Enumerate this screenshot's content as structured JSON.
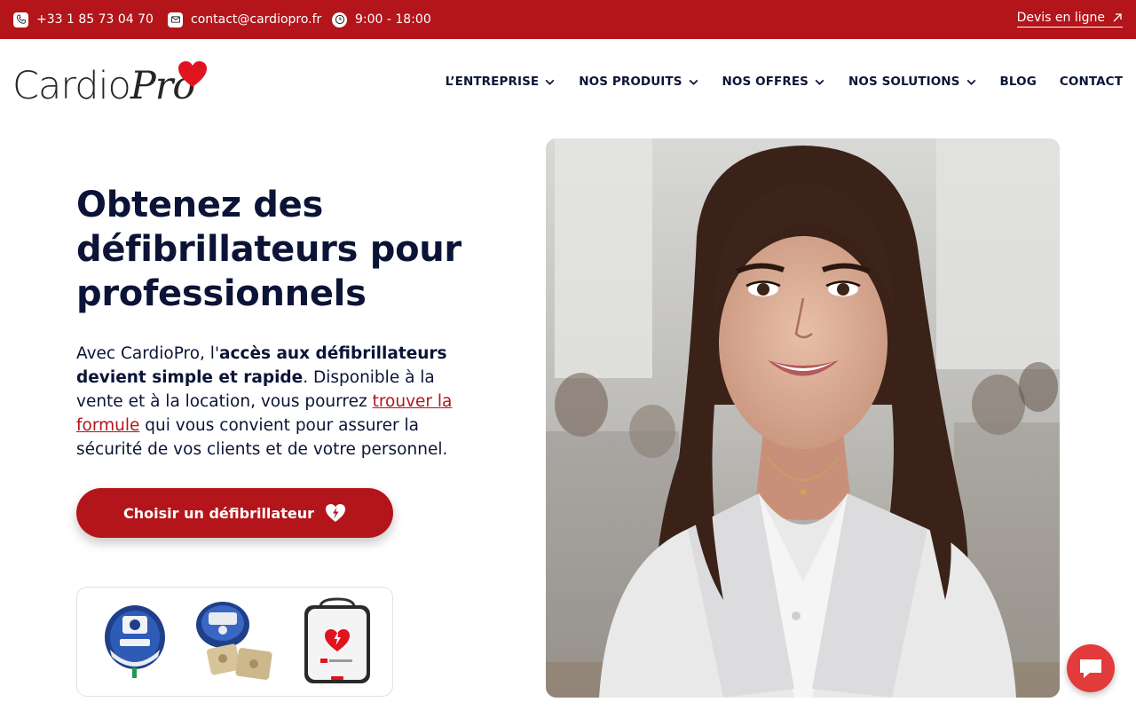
{
  "topbar": {
    "phone": "+33 1 85 73 04 70",
    "email": "contact@cardiopro.fr",
    "hours": "9:00 - 18:00",
    "devis_label": "Devis en ligne",
    "background": "#b3151b",
    "icons": [
      "phone-icon",
      "mail-icon",
      "clock-icon",
      "arrow-up-right-icon"
    ]
  },
  "logo": {
    "text_part1": "Cardio",
    "text_part2": "Pro",
    "heart_color": "#e0141e"
  },
  "nav": {
    "items": [
      {
        "label": "L’ENTREPRISE",
        "has_dropdown": true
      },
      {
        "label": "NOS PRODUITS",
        "has_dropdown": true
      },
      {
        "label": "NOS OFFRES",
        "has_dropdown": true
      },
      {
        "label": "NOS SOLUTIONS",
        "has_dropdown": true
      },
      {
        "label": "BLOG",
        "has_dropdown": false
      },
      {
        "label": "CONTACT",
        "has_dropdown": false
      }
    ]
  },
  "hero": {
    "title_line1": "Obtenez des",
    "title_line2": "défibrillateurs pour",
    "title_line3": "professionnels",
    "text_part1": "Avec CardioPro, l'",
    "text_bold": "accès aux défibrillateurs devient simple et rapide",
    "text_part2": ". Disponible à la vente et à la location, vous pourrez ",
    "text_link": "trouver la formule",
    "text_part3": " qui vous convient pour assurer la sécurité de vos clients et de votre personnel.",
    "cta_label": "Choisir un défibrillateur",
    "cta_icon": "heart-bolt-icon",
    "accent_color": "#b3151b",
    "text_color": "#0b1437"
  },
  "products": {
    "images": [
      "defibrillator-round-blue-image",
      "defibrillator-with-pads-image",
      "defibrillator-case-image"
    ]
  },
  "chat": {
    "icon": "chat-bubble-icon",
    "color": "#e23b3b"
  }
}
